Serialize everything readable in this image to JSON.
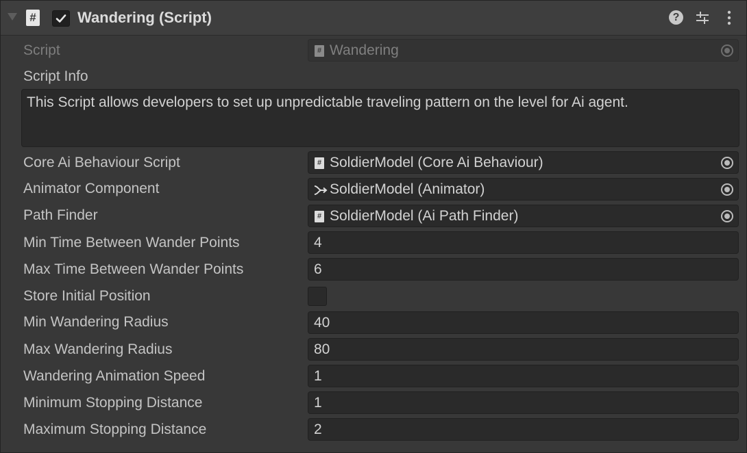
{
  "component": {
    "title": "Wandering (Script)",
    "enabled": true,
    "header_icons": [
      "foldout-arrow-icon",
      "csharp-script-icon",
      "help-icon",
      "presets-icon",
      "more-menu-icon"
    ]
  },
  "script_row": {
    "label": "Script",
    "value": "Wandering",
    "icon": "csharp-script-icon"
  },
  "script_info": {
    "label": "Script Info",
    "text": "This Script allows developers to set up unpredictable traveling pattern on the level for Ai agent."
  },
  "object_fields": [
    {
      "label": "Core Ai Behaviour Script",
      "value": "SoldierModel (Core Ai Behaviour)",
      "icon": "csharp-script-icon"
    },
    {
      "label": "Animator Component",
      "value": "SoldierModel (Animator)",
      "icon": "animator-icon"
    },
    {
      "label": "Path Finder",
      "value": "SoldierModel (Ai Path Finder)",
      "icon": "csharp-script-icon"
    }
  ],
  "value_fields": [
    {
      "label": "Min Time Between Wander Points",
      "value": "4"
    },
    {
      "label": "Max Time Between Wander Points",
      "value": "6"
    }
  ],
  "toggle_field": {
    "label": "Store Initial Position",
    "checked": false
  },
  "value_fields_2": [
    {
      "label": "Min Wandering Radius",
      "value": "40"
    },
    {
      "label": "Max Wandering Radius",
      "value": "80"
    },
    {
      "label": "Wandering Animation Speed",
      "value": "1"
    },
    {
      "label": "Minimum Stopping Distance",
      "value": "1"
    },
    {
      "label": "Maximum Stopping Distance",
      "value": "2"
    }
  ]
}
